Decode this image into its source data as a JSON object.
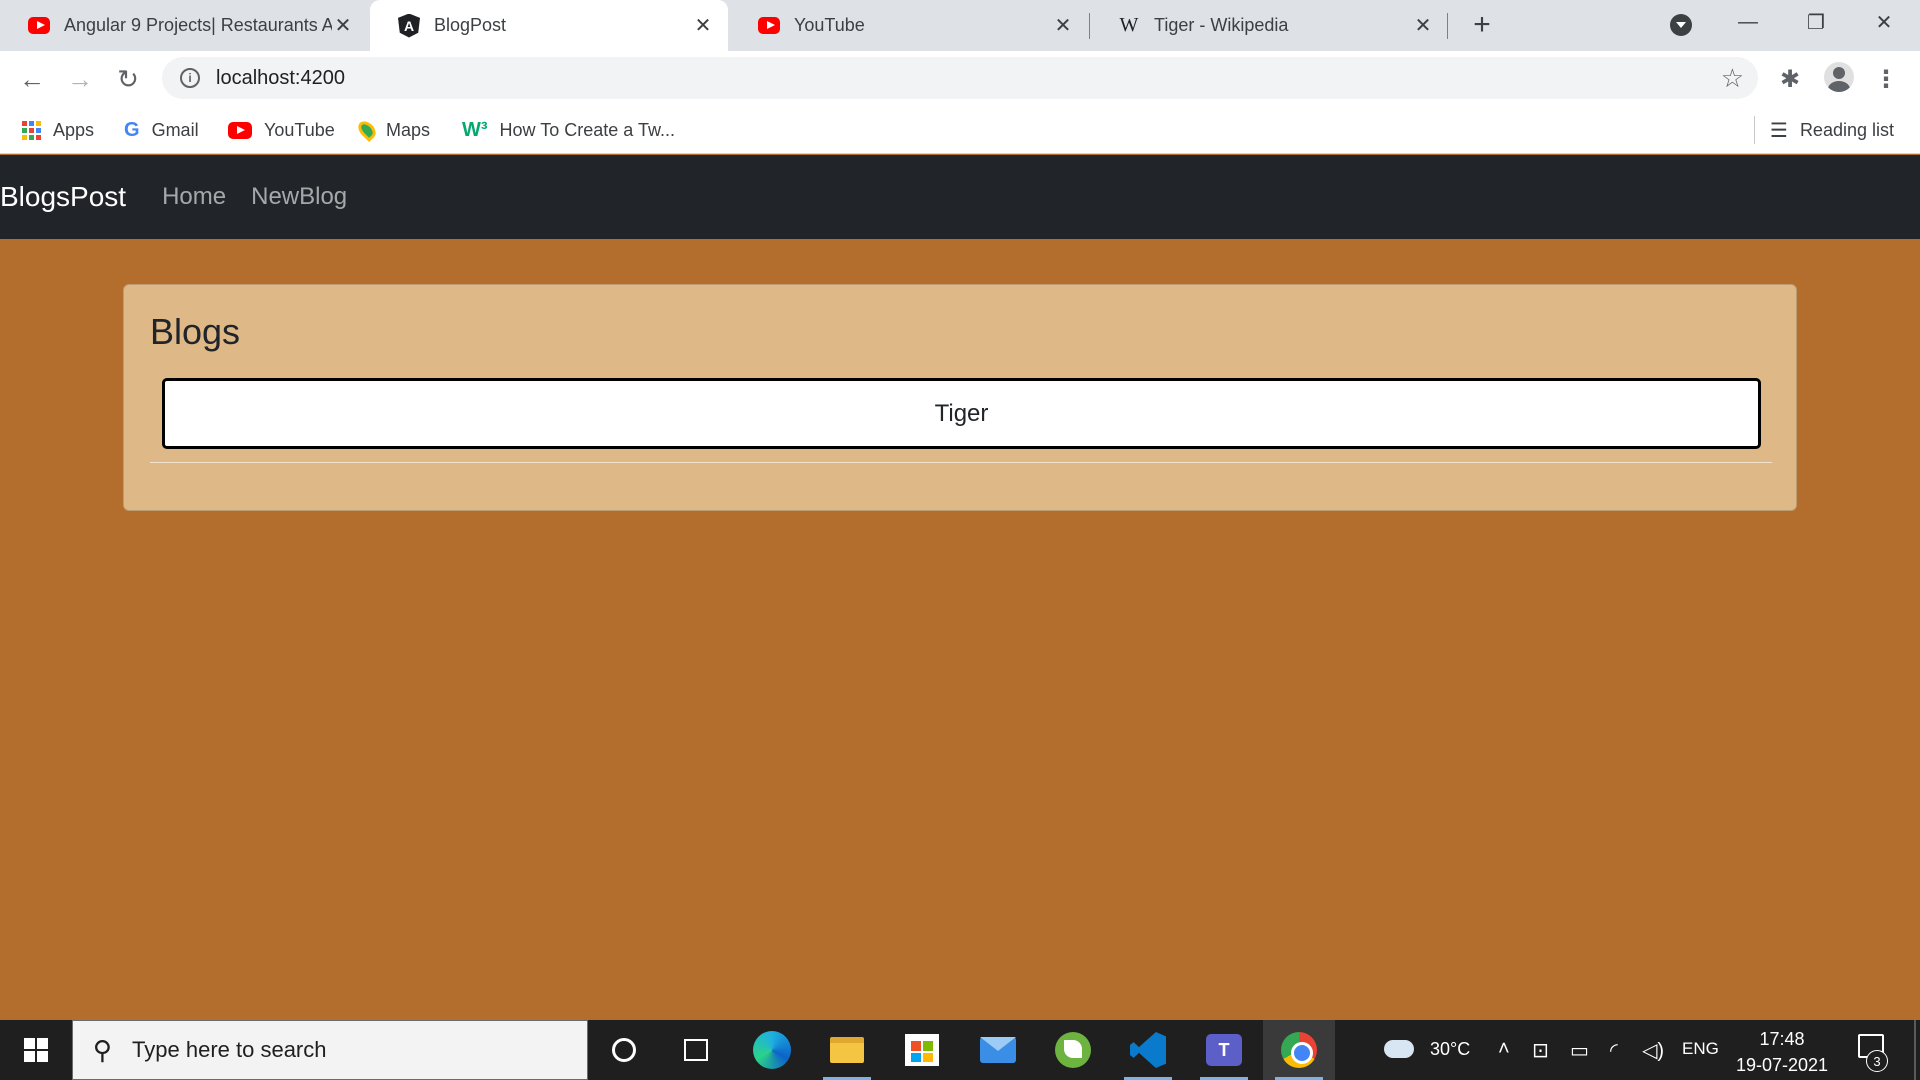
{
  "browser": {
    "tabs": [
      {
        "title": "Angular 9 Projects| Restaurants A",
        "icon": "youtube-icon",
        "active": false
      },
      {
        "title": "BlogPost",
        "icon": "angular-icon",
        "active": true
      },
      {
        "title": "YouTube",
        "icon": "youtube-icon",
        "active": false
      },
      {
        "title": "Tiger - Wikipedia",
        "icon": "wikipedia-icon",
        "active": false
      }
    ],
    "url": "localhost:4200",
    "bookmarks": [
      {
        "label": "Apps",
        "icon": "apps-grid-icon"
      },
      {
        "label": "Gmail",
        "icon": "google-icon"
      },
      {
        "label": "YouTube",
        "icon": "youtube-icon"
      },
      {
        "label": "Maps",
        "icon": "maps-pin-icon"
      },
      {
        "label": "How To Create a Tw...",
        "icon": "w3schools-icon"
      }
    ],
    "reading_list_label": "Reading list"
  },
  "app": {
    "brand": "BlogsPost",
    "nav": [
      "Home",
      "NewBlog"
    ],
    "heading": "Blogs",
    "blogs": [
      "Tiger"
    ],
    "colors": {
      "page_background": "#b36d2c",
      "card_background": "#deb887",
      "navbar_background": "#212529"
    }
  },
  "taskbar": {
    "search_placeholder": "Type here to search",
    "weather": "30°C",
    "language": "ENG",
    "time": "17:48",
    "date": "19-07-2021",
    "notification_count": "3",
    "pinned_apps": [
      "cortana",
      "task-view",
      "edge",
      "file-explorer",
      "microsoft-store",
      "mail",
      "spring-tool-suite",
      "vs-code",
      "teams",
      "chrome"
    ]
  }
}
